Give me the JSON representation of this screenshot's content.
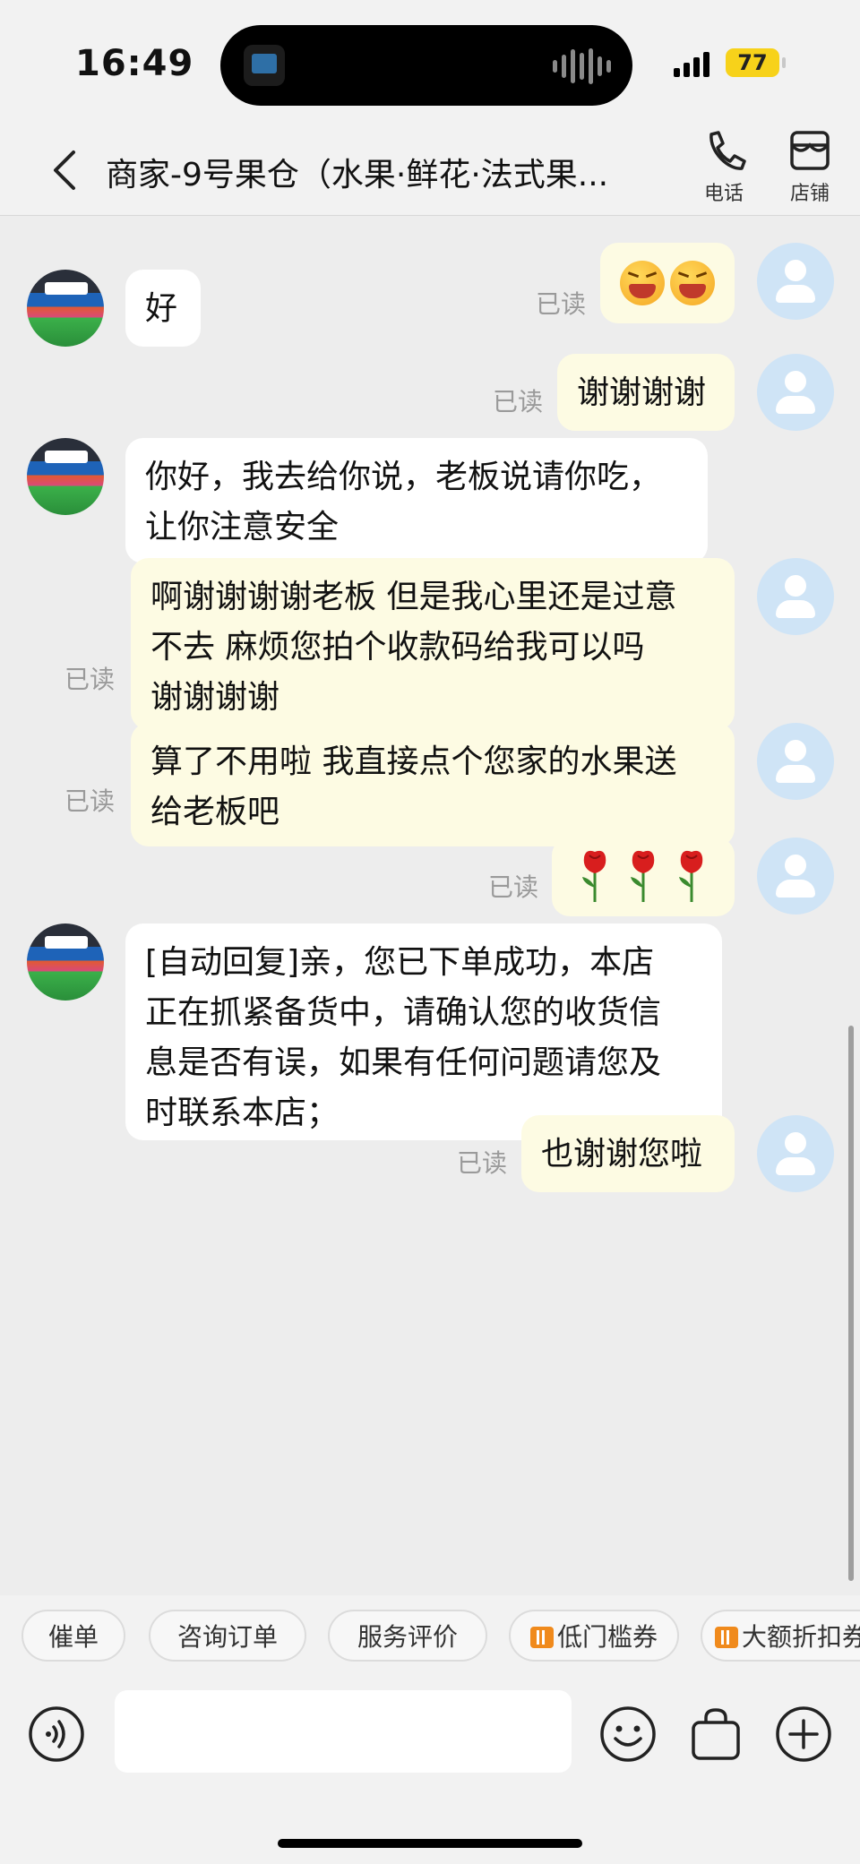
{
  "status": {
    "time": "16:49",
    "battery": "77"
  },
  "header": {
    "title": "商家-9号果仓（水果·鲜花·法式果...",
    "phone_label": "电话",
    "store_label": "店铺"
  },
  "read_label": "已读",
  "messages": [
    {
      "from": "me",
      "type": "emoji",
      "emoji": "laughing-face-icon x2"
    },
    {
      "from": "shop",
      "text": "好"
    },
    {
      "from": "me",
      "text": "谢谢谢谢"
    },
    {
      "from": "shop",
      "lines": [
        "你好，我去给你说，老板说请你吃，",
        "让你注意安全"
      ]
    },
    {
      "from": "me",
      "lines": [
        "啊谢谢谢谢老板 但是我心里还是过意",
        "不去 麻烦您拍个收款码给我可以吗",
        "谢谢谢谢"
      ]
    },
    {
      "from": "me",
      "lines": [
        "算了不用啦 我直接点个您家的水果送",
        "给老板吧"
      ]
    },
    {
      "from": "me",
      "type": "emoji",
      "emoji": "rose-icon x3"
    },
    {
      "from": "shop",
      "lines": [
        "[自动回复]亲，您已下单成功，本店",
        "正在抓紧备货中，请确认您的收货信",
        "息是否有误，如果有任何问题请您及",
        "时联系本店；"
      ]
    },
    {
      "from": "me",
      "text": "也谢谢您啦"
    }
  ],
  "quick_actions": [
    "催单",
    "咨询订单",
    "服务评价",
    "低门槛券",
    "大额折扣券"
  ],
  "colors": {
    "my_bubble": "#fdfbe3",
    "shop_bubble": "#ffffff",
    "background": "#ededed",
    "coupon_icon": "#f08a1c"
  }
}
